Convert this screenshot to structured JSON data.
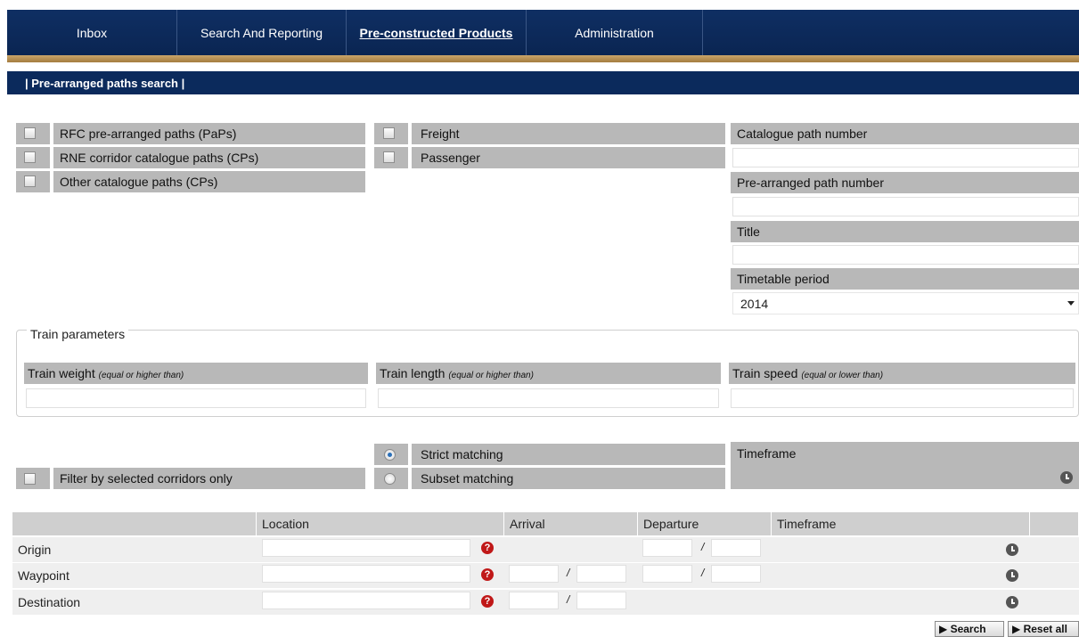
{
  "nav": {
    "items": [
      {
        "label": "Inbox"
      },
      {
        "label": "Search And Reporting"
      },
      {
        "label": "Pre-constructed Products"
      },
      {
        "label": "Administration"
      }
    ]
  },
  "section_title": "| Pre-arranged paths search |",
  "path_types": [
    {
      "label": "RFC pre-arranged paths (PaPs)"
    },
    {
      "label": "RNE corridor catalogue paths (CPs)"
    },
    {
      "label": "Other catalogue paths (CPs)"
    }
  ],
  "traffic_types": [
    {
      "label": "Freight"
    },
    {
      "label": "Passenger"
    }
  ],
  "fields": {
    "catalogue_path_number": "Catalogue path number",
    "pre_arranged_path_number": "Pre-arranged path number",
    "title": "Title",
    "timetable_period": "Timetable period",
    "timetable_value": "2014"
  },
  "train_parameters": {
    "legend": "Train parameters",
    "weight": {
      "label": "Train weight",
      "hint": "(equal or higher than)"
    },
    "length": {
      "label": "Train length",
      "hint": "(equal or higher than)"
    },
    "speed": {
      "label": "Train speed",
      "hint": "(equal or lower than)"
    }
  },
  "filter_corridors": "Filter by selected corridors only",
  "matching": {
    "strict": "Strict matching",
    "subset": "Subset matching"
  },
  "timeframe_label": "Timeframe",
  "table": {
    "headers": {
      "location": "Location",
      "arrival": "Arrival",
      "departure": "Departure",
      "timeframe": "Timeframe"
    },
    "rows": [
      {
        "label": "Origin"
      },
      {
        "label": "Waypoint"
      },
      {
        "label": "Destination"
      }
    ],
    "help_glyph": "?",
    "slash": "/"
  },
  "buttons": {
    "search": "▶ Search",
    "reset": "▶ Reset all"
  }
}
